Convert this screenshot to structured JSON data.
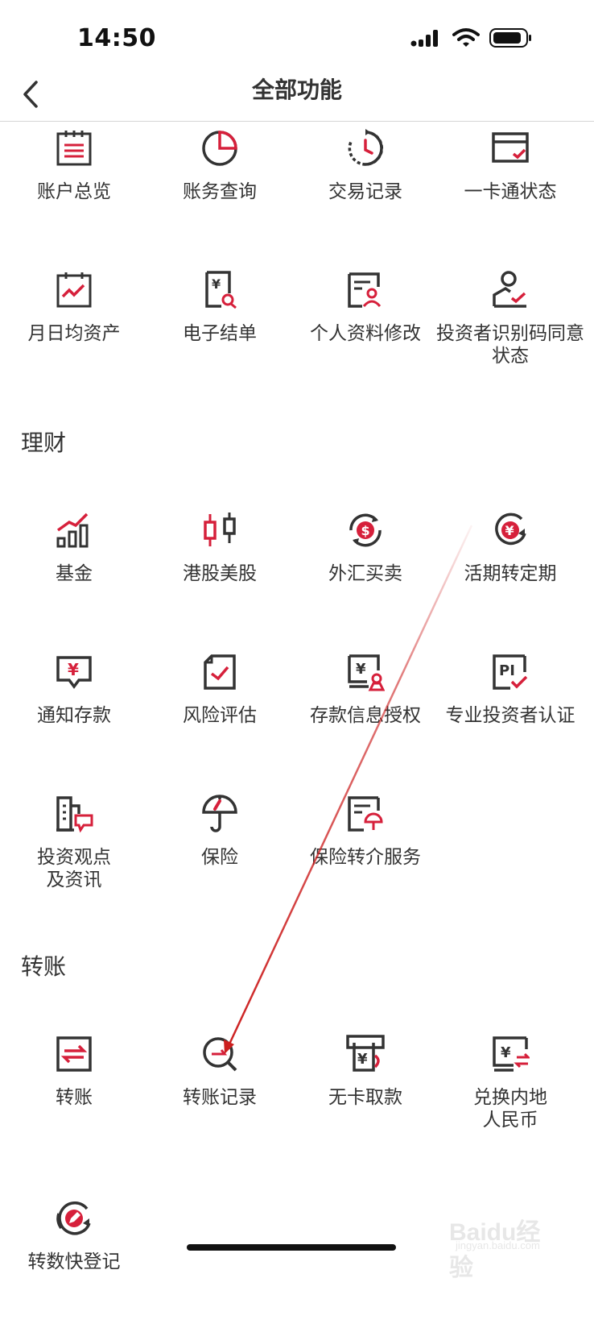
{
  "status_bar": {
    "time": "14:50"
  },
  "nav": {
    "title": "全部功能"
  },
  "accounts": {
    "items": [
      {
        "label": "账户总览",
        "icon": "clipboard-list-icon"
      },
      {
        "label": "账务查询",
        "icon": "pie-chart-icon"
      },
      {
        "label": "交易记录",
        "icon": "history-clock-icon"
      },
      {
        "label": "一卡通状态",
        "icon": "card-check-icon"
      },
      {
        "label": "月日均资产",
        "icon": "calendar-trend-icon"
      },
      {
        "label": "电子结单",
        "icon": "statement-search-icon"
      },
      {
        "label": "个人资料修改",
        "icon": "profile-edit-icon"
      },
      {
        "label": "投资者识别码同意状态",
        "icon": "user-check-icon"
      }
    ]
  },
  "wealth": {
    "title": "理财",
    "items": [
      {
        "label": "基金",
        "icon": "bar-trend-icon"
      },
      {
        "label": "港股美股",
        "icon": "candlestick-icon"
      },
      {
        "label": "外汇买卖",
        "icon": "currency-exchange-icon"
      },
      {
        "label": "活期转定期",
        "icon": "yuan-cycle-icon"
      },
      {
        "label": "通知存款",
        "icon": "yuan-message-icon"
      },
      {
        "label": "风险评估",
        "icon": "document-check-icon"
      },
      {
        "label": "存款信息授权",
        "icon": "yuan-authorize-icon"
      },
      {
        "label": "专业投资者认证",
        "icon": "pi-check-icon"
      },
      {
        "label": "投资观点及资讯",
        "icon": "building-news-icon"
      },
      {
        "label": "保险",
        "icon": "umbrella-icon"
      },
      {
        "label": "保险转介服务",
        "icon": "document-umbrella-icon"
      }
    ]
  },
  "transfer": {
    "title": "转账",
    "items": [
      {
        "label": "转账",
        "icon": "transfer-arrows-icon"
      },
      {
        "label": "转账记录",
        "icon": "transfer-search-icon"
      },
      {
        "label": "无卡取款",
        "icon": "atm-cash-icon"
      },
      {
        "label": "兑换内地人民币",
        "icon": "yuan-exchange-icon"
      },
      {
        "label": "转数快登记",
        "icon": "fps-edit-icon"
      }
    ]
  },
  "watermark": {
    "text": "Baidu经验",
    "sub": "jingyan.baidu.com"
  },
  "colors": {
    "accent": "#d6203b",
    "icon_dark": "#333333",
    "annotation_arrow": "#cc1f1f"
  }
}
